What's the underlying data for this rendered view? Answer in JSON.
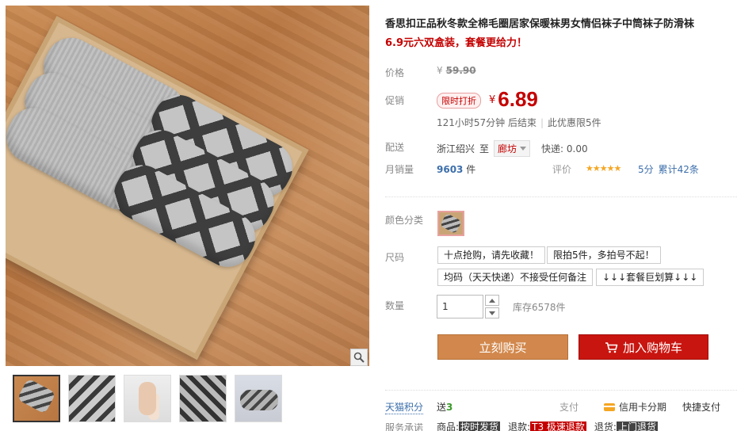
{
  "product": {
    "title": "香思扣正品秋冬款全棉毛圈居家保暖袜男女情侣袜子中筒袜子防滑袜",
    "subtitle": "6.9元六双盒装，套餐更给力！"
  },
  "labels": {
    "price": "价格",
    "promo": "促销",
    "shipping": "配送",
    "monthly_sales": "月销量",
    "color": "颜色分类",
    "size": "尺码",
    "quantity": "数量",
    "tmall_points": "天猫积分",
    "service": "服务承诺"
  },
  "price": {
    "currency": "¥",
    "original": "59.90",
    "promo_badge": "限时打折",
    "promo_value": "6.89",
    "countdown": "121小时57分钟 后结束",
    "limit": "此优惠限5件"
  },
  "shipping": {
    "origin": "浙江绍兴",
    "to": "至",
    "destination": "廊坊",
    "fee": "快递: 0.00"
  },
  "sales": {
    "count": "9603",
    "unit": "件",
    "review_label": "评价",
    "stars": "★★★★★",
    "score": "5分",
    "review_count": "累计42条"
  },
  "sizes": [
    "十点抢购，请先收藏！",
    "限拍5件，多拍号不起！",
    "均码（天天快递）不接受任何备注",
    "↓↓↓套餐巨划算↓↓↓"
  ],
  "quantity": {
    "value": "1",
    "stock": "库存6578件"
  },
  "buttons": {
    "buy_now": "立刻购买",
    "add_cart": "加入购物车"
  },
  "points": {
    "prefix": "送",
    "value": "3"
  },
  "payment": {
    "label": "支付",
    "credit": "信用卡分期",
    "quick": "快捷支付"
  },
  "service": {
    "goods_prefix": "商品:",
    "goods_tag": "按时发货",
    "refund_prefix": "退款:",
    "refund_tag": "T3 极速退款",
    "return_prefix": "退货:",
    "return_tag": "上门退货"
  },
  "colors": {
    "accent_red": "#c40000",
    "buy_button": "#d2884c",
    "cart_button": "#c9150f",
    "link_blue": "#3d6fab"
  }
}
